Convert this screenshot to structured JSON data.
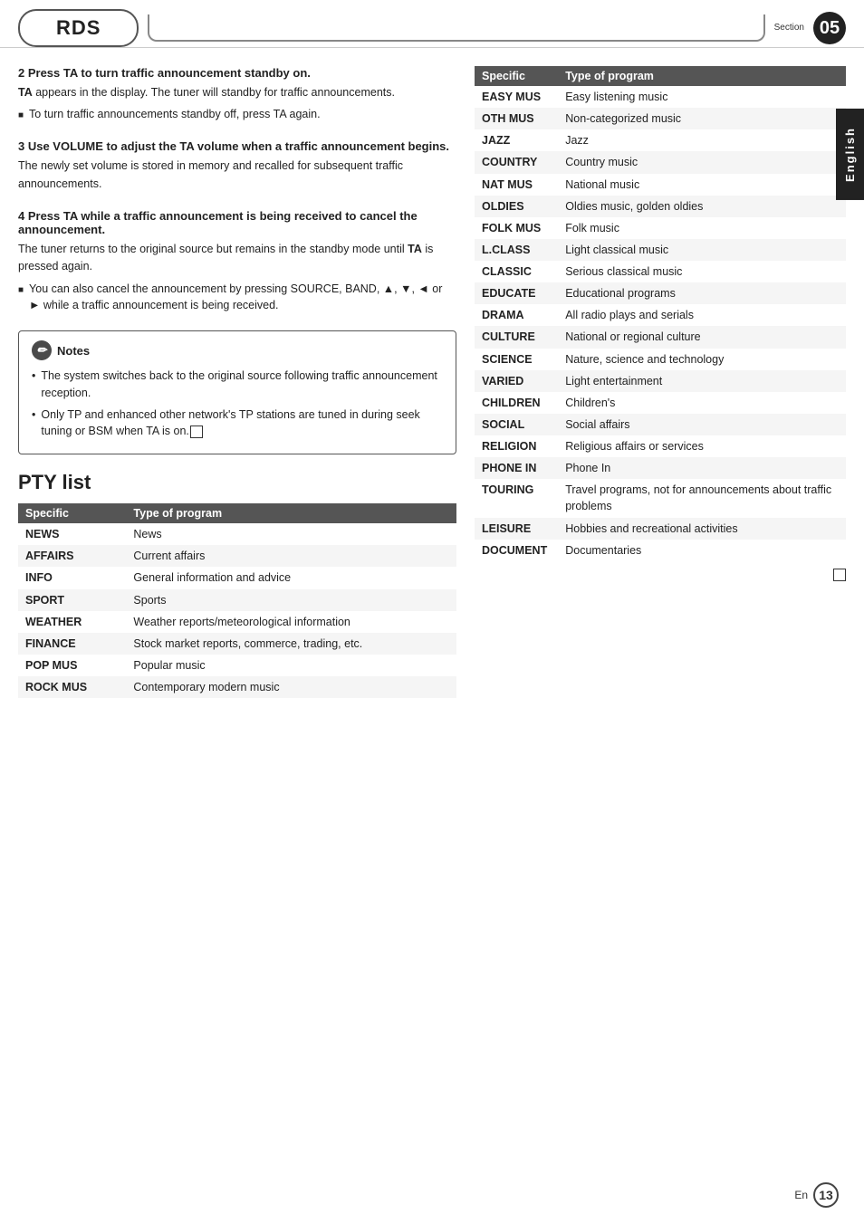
{
  "header": {
    "rds_label": "RDS",
    "section_label": "Section",
    "section_num": "05"
  },
  "english_tab": "English",
  "steps": [
    {
      "id": "step2",
      "title": "2   Press TA to turn traffic announcement standby on.",
      "body_parts": [
        {
          "type": "text",
          "text": "TA",
          "bold": true
        },
        {
          "type": "text",
          "text": " appears in the display. The tuner will standby for traffic announcements."
        }
      ],
      "bullet": "To turn traffic announcements standby off, press TA again.",
      "bullet_bold": "TA"
    },
    {
      "id": "step3",
      "title": "3   Use VOLUME to adjust the TA volume when a traffic announcement begins.",
      "body": "The newly set volume is stored in memory and recalled for subsequent traffic announcements."
    },
    {
      "id": "step4",
      "title": "4   Press TA while a traffic announcement is being received to cancel the announcement.",
      "body": "The tuner returns to the original source but remains in the standby mode until TA is pressed again.",
      "body_ta_bold": "TA",
      "bullet": "You can also cancel the announcement by pressing SOURCE, BAND, ▲, ▼, ◄ or ► while a traffic announcement is being received.",
      "bullet_bolds": [
        "SOURCE",
        "BAND"
      ]
    }
  ],
  "notes": {
    "header": "Notes",
    "items": [
      "The system switches back to the original source following traffic announcement reception.",
      "Only TP and enhanced other network's TP stations are tuned in during seek tuning or BSM when TA is on."
    ]
  },
  "pty_section": {
    "title": "PTY list",
    "table": {
      "headers": [
        "Specific",
        "Type of program"
      ],
      "rows": [
        [
          "NEWS",
          "News"
        ],
        [
          "AFFAIRS",
          "Current affairs"
        ],
        [
          "INFO",
          "General information and advice"
        ],
        [
          "SPORT",
          "Sports"
        ],
        [
          "WEATHER",
          "Weather reports/meteorological information"
        ],
        [
          "FINANCE",
          "Stock market reports, commerce, trading, etc."
        ],
        [
          "POP MUS",
          "Popular music"
        ],
        [
          "ROCK MUS",
          "Contemporary modern music"
        ]
      ]
    }
  },
  "right_table": {
    "headers": [
      "Specific",
      "Type of program"
    ],
    "rows": [
      [
        "EASY MUS",
        "Easy listening music"
      ],
      [
        "OTH MUS",
        "Non-categorized music"
      ],
      [
        "JAZZ",
        "Jazz"
      ],
      [
        "COUNTRY",
        "Country music"
      ],
      [
        "NAT MUS",
        "National music"
      ],
      [
        "OLDIES",
        "Oldies music, golden oldies"
      ],
      [
        "FOLK MUS",
        "Folk music"
      ],
      [
        "L.CLASS",
        "Light classical music"
      ],
      [
        "CLASSIC",
        "Serious classical music"
      ],
      [
        "EDUCATE",
        "Educational programs"
      ],
      [
        "DRAMA",
        "All radio plays and serials"
      ],
      [
        "CULTURE",
        "National or regional culture"
      ],
      [
        "SCIENCE",
        "Nature, science and technology"
      ],
      [
        "VARIED",
        "Light entertainment"
      ],
      [
        "CHILDREN",
        "Children's"
      ],
      [
        "SOCIAL",
        "Social affairs"
      ],
      [
        "RELIGION",
        "Religious affairs or services"
      ],
      [
        "PHONE IN",
        "Phone In"
      ],
      [
        "TOURING",
        "Travel programs, not for announcements about traffic problems"
      ],
      [
        "LEISURE",
        "Hobbies and recreational activities"
      ],
      [
        "DOCUMENT",
        "Documentaries"
      ]
    ]
  },
  "footer": {
    "en_label": "En",
    "page_num": "13"
  }
}
